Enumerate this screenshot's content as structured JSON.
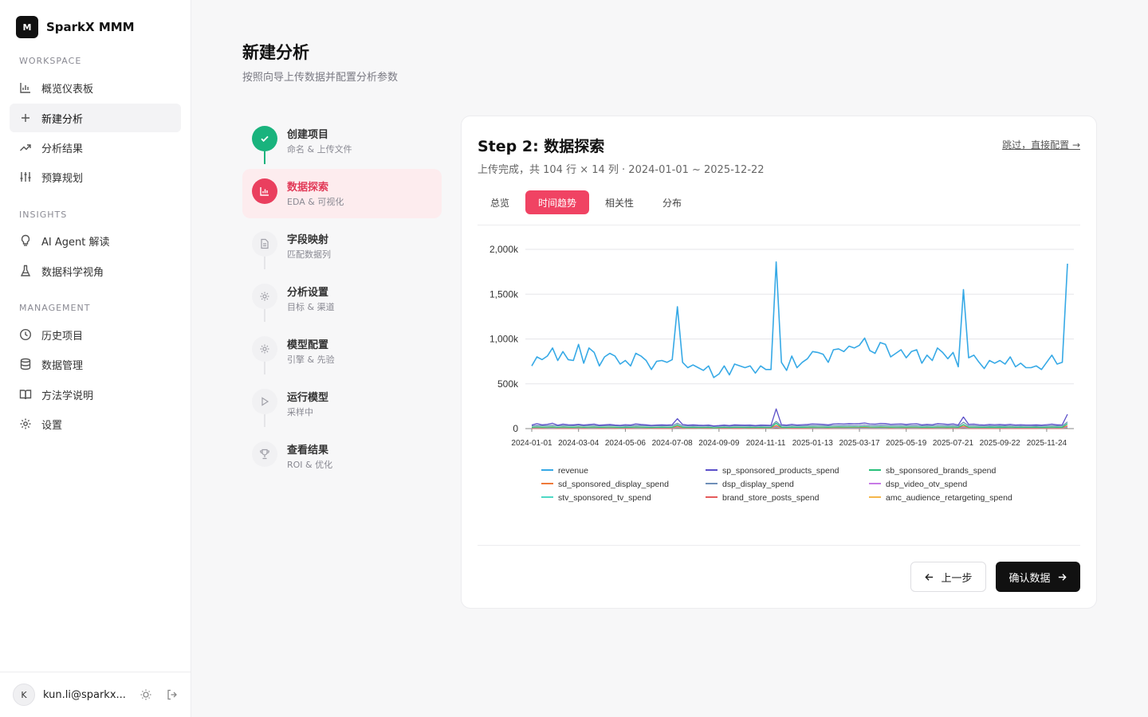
{
  "app": {
    "logo_letter": "M",
    "name": "SparkX MMM"
  },
  "sidebar": {
    "workspace_label": "WORKSPACE",
    "insights_label": "INSIGHTS",
    "management_label": "MANAGEMENT",
    "items": [
      {
        "label": "概览仪表板",
        "icon": "bar-chart-icon"
      },
      {
        "label": "新建分析",
        "icon": "plus-icon",
        "active": true
      },
      {
        "label": "分析结果",
        "icon": "trending-up-icon"
      },
      {
        "label": "预算规划",
        "icon": "sliders-icon"
      },
      {
        "label": "AI Agent 解读",
        "icon": "lightbulb-icon"
      },
      {
        "label": "数据科学视角",
        "icon": "flask-icon"
      },
      {
        "label": "历史项目",
        "icon": "clock-icon"
      },
      {
        "label": "数据管理",
        "icon": "database-icon"
      },
      {
        "label": "方法学说明",
        "icon": "book-icon"
      },
      {
        "label": "设置",
        "icon": "gear-icon"
      }
    ]
  },
  "user": {
    "avatar": "K",
    "email": "kun.li@sparkx..."
  },
  "page": {
    "title": "新建分析",
    "subtitle": "按照向导上传数据并配置分析参数"
  },
  "steps": [
    {
      "title": "创建项目",
      "sub": "命名 & 上传文件",
      "status": "done",
      "icon": "check-icon"
    },
    {
      "title": "数据探索",
      "sub": "EDA & 可视化",
      "status": "current",
      "icon": "bar-chart-icon"
    },
    {
      "title": "字段映射",
      "sub": "匹配数据列",
      "status": "pending",
      "icon": "file-icon"
    },
    {
      "title": "分析设置",
      "sub": "目标 & 渠道",
      "status": "pending",
      "icon": "gear-icon"
    },
    {
      "title": "模型配置",
      "sub": "引擎 & 先验",
      "status": "pending",
      "icon": "gear-icon"
    },
    {
      "title": "运行模型",
      "sub": "采样中",
      "status": "pending",
      "icon": "play-icon"
    },
    {
      "title": "查看结果",
      "sub": "ROI & 优化",
      "status": "pending",
      "icon": "trophy-icon"
    }
  ],
  "card": {
    "title": "Step 2: 数据探索",
    "skip": "跳过，直接配置 →",
    "info": "上传完成，共 104 行 × 14 列 · 2024-01-01 ~ 2025-12-22",
    "tabs": [
      "总览",
      "时间趋势",
      "相关性",
      "分布"
    ],
    "active_tab": 1,
    "prev_label": "上一步",
    "next_label": "确认数据"
  },
  "chart_data": {
    "type": "line",
    "x_start": "2024-01-01",
    "x_end": "2025-12-22",
    "x_tick_labels": [
      "2024-01-01",
      "2024-03-04",
      "2024-05-06",
      "2024-07-08",
      "2024-09-09",
      "2024-11-11",
      "2025-01-13",
      "2025-03-17",
      "2025-05-19",
      "2025-07-21",
      "2025-09-22",
      "2025-11-24"
    ],
    "y_tick_labels": [
      "0",
      "500k",
      "1,000k",
      "1,500k",
      "2,000k"
    ],
    "y_ticks": [
      0,
      500,
      1000,
      1500,
      2000
    ],
    "y_unit": "k",
    "ylim": [
      0,
      2000
    ],
    "grid": "horizontal",
    "legend_position": "bottom",
    "series": [
      {
        "name": "revenue",
        "color": "#36a9e6",
        "values": [
          700,
          800,
          770,
          810,
          900,
          760,
          860,
          770,
          760,
          940,
          730,
          900,
          850,
          700,
          800,
          840,
          810,
          720,
          760,
          700,
          840,
          810,
          760,
          660,
          750,
          760,
          740,
          770,
          1360,
          740,
          680,
          710,
          680,
          650,
          700,
          570,
          610,
          700,
          600,
          720,
          700,
          680,
          700,
          620,
          700,
          660,
          660,
          1860,
          740,
          650,
          810,
          680,
          740,
          780,
          860,
          850,
          830,
          740,
          880,
          890,
          860,
          920,
          900,
          930,
          1010,
          870,
          840,
          960,
          940,
          800,
          840,
          880,
          790,
          860,
          880,
          730,
          820,
          760,
          900,
          850,
          780,
          850,
          690,
          1550,
          790,
          820,
          740,
          670,
          760,
          730,
          760,
          720,
          800,
          690,
          730,
          680,
          680,
          700,
          660,
          740,
          820,
          720,
          740,
          1840
        ]
      },
      {
        "name": "sp_sponsored_products_spend",
        "color": "#5b4fc9",
        "values": [
          40,
          55,
          42,
          48,
          60,
          38,
          50,
          44,
          42,
          48,
          40,
          45,
          50,
          38,
          42,
          46,
          40,
          36,
          44,
          40,
          52,
          46,
          42,
          36,
          40,
          42,
          40,
          44,
          110,
          46,
          38,
          42,
          38,
          36,
          40,
          30,
          34,
          40,
          34,
          42,
          40,
          38,
          40,
          34,
          40,
          38,
          36,
          220,
          44,
          38,
          48,
          40,
          44,
          46,
          52,
          50,
          48,
          42,
          52,
          54,
          52,
          56,
          54,
          56,
          62,
          52,
          50,
          58,
          56,
          48,
          50,
          52,
          46,
          52,
          54,
          42,
          48,
          44,
          56,
          52,
          46,
          52,
          40,
          130,
          48,
          50,
          44,
          40,
          46,
          44,
          46,
          42,
          48,
          40,
          44,
          40,
          40,
          42,
          38,
          44,
          50,
          42,
          44,
          160
        ]
      },
      {
        "name": "sb_sponsored_brands_spend",
        "color": "#27c07a",
        "values": [
          15,
          18,
          16,
          17,
          20,
          14,
          18,
          16,
          15,
          19,
          14,
          17,
          18,
          14,
          16,
          17,
          16,
          13,
          15,
          14,
          18,
          17,
          15,
          12,
          14,
          15,
          14,
          15,
          40,
          15,
          13,
          14,
          13,
          12,
          14,
          10,
          12,
          14,
          12,
          14,
          14,
          13,
          14,
          12,
          14,
          13,
          12,
          60,
          15,
          13,
          16,
          14,
          15,
          16,
          18,
          17,
          17,
          15,
          18,
          19,
          18,
          19,
          19,
          20,
          22,
          18,
          17,
          20,
          19,
          16,
          17,
          18,
          16,
          18,
          18,
          15,
          17,
          15,
          19,
          18,
          16,
          18,
          14,
          45,
          16,
          17,
          15,
          14,
          16,
          15,
          16,
          15,
          17,
          14,
          15,
          14,
          14,
          15,
          13,
          15,
          17,
          15,
          15,
          55
        ]
      },
      {
        "name": "sd_sponsored_display_spend",
        "color": "#ef7a3a",
        "values": [
          10,
          12,
          11,
          12,
          14,
          10,
          12,
          11,
          10,
          13,
          10,
          12,
          12,
          10,
          11,
          12,
          11,
          9,
          10,
          10,
          12,
          12,
          11,
          8,
          10,
          10,
          10,
          11,
          25,
          10,
          9,
          10,
          9,
          8,
          10,
          7,
          8,
          10,
          8,
          10,
          10,
          9,
          10,
          8,
          10,
          9,
          8,
          35,
          10,
          9,
          11,
          10,
          10,
          11,
          12,
          12,
          12,
          10,
          12,
          13,
          12,
          13,
          13,
          14,
          15,
          12,
          12,
          14,
          13,
          11,
          12,
          12,
          11,
          12,
          12,
          10,
          11,
          10,
          13,
          12,
          11,
          12,
          10,
          28,
          11,
          12,
          10,
          10,
          11,
          10,
          11,
          10,
          12,
          10,
          10,
          10,
          10,
          10,
          9,
          10,
          12,
          10,
          10,
          32
        ]
      },
      {
        "name": "dsp_display_spend",
        "color": "#6f8fb8",
        "values": [
          30,
          34,
          32,
          33,
          38,
          30,
          34,
          32,
          31,
          36,
          29,
          34,
          34,
          29,
          32,
          33,
          32,
          28,
          30,
          29,
          34,
          33,
          31,
          27,
          30,
          30,
          30,
          31,
          60,
          30,
          28,
          29,
          28,
          27,
          29,
          24,
          26,
          29,
          26,
          29,
          29,
          28,
          29,
          26,
          29,
          28,
          27,
          80,
          30,
          28,
          32,
          29,
          30,
          32,
          34,
          34,
          33,
          30,
          35,
          35,
          34,
          36,
          35,
          36,
          40,
          34,
          33,
          38,
          37,
          32,
          33,
          35,
          32,
          34,
          35,
          30,
          33,
          31,
          36,
          34,
          31,
          34,
          28,
          70,
          32,
          33,
          30,
          28,
          31,
          30,
          31,
          29,
          32,
          28,
          30,
          28,
          28,
          29,
          27,
          30,
          33,
          29,
          30,
          75
        ]
      },
      {
        "name": "dsp_video_otv_spend",
        "color": "#c77ae6",
        "values": [
          8,
          9,
          8,
          9,
          10,
          8,
          9,
          8,
          8,
          10,
          7,
          9,
          9,
          7,
          8,
          9,
          8,
          7,
          8,
          7,
          9,
          9,
          8,
          6,
          7,
          8,
          7,
          8,
          18,
          8,
          7,
          7,
          7,
          6,
          7,
          5,
          6,
          7,
          6,
          7,
          7,
          7,
          7,
          6,
          7,
          7,
          6,
          25,
          8,
          7,
          8,
          7,
          8,
          8,
          9,
          9,
          9,
          8,
          9,
          10,
          9,
          10,
          10,
          10,
          11,
          9,
          9,
          10,
          10,
          8,
          9,
          9,
          8,
          9,
          9,
          8,
          8,
          8,
          10,
          9,
          8,
          9,
          7,
          20,
          8,
          9,
          8,
          7,
          8,
          8,
          8,
          7,
          8,
          7,
          8,
          7,
          7,
          7,
          7,
          8,
          9,
          7,
          8,
          22
        ]
      },
      {
        "name": "stv_sponsored_tv_spend",
        "color": "#4ed8c5",
        "values": [
          5,
          6,
          5,
          6,
          7,
          5,
          6,
          5,
          5,
          6,
          5,
          6,
          6,
          5,
          5,
          6,
          5,
          4,
          5,
          5,
          6,
          6,
          5,
          4,
          5,
          5,
          5,
          5,
          12,
          5,
          4,
          5,
          4,
          4,
          5,
          3,
          4,
          5,
          4,
          5,
          5,
          4,
          5,
          4,
          5,
          4,
          4,
          18,
          5,
          4,
          5,
          5,
          5,
          5,
          6,
          6,
          6,
          5,
          6,
          6,
          6,
          6,
          6,
          7,
          7,
          6,
          6,
          7,
          6,
          5,
          6,
          6,
          5,
          6,
          6,
          5,
          5,
          5,
          6,
          6,
          5,
          6,
          5,
          14,
          5,
          6,
          5,
          5,
          5,
          5,
          5,
          5,
          5,
          5,
          5,
          5,
          5,
          5,
          4,
          5,
          6,
          5,
          5,
          15
        ]
      },
      {
        "name": "brand_store_posts_spend",
        "color": "#e55a5a",
        "values": [
          3,
          4,
          3,
          4,
          4,
          3,
          4,
          3,
          3,
          4,
          3,
          4,
          4,
          3,
          3,
          4,
          3,
          3,
          3,
          3,
          4,
          4,
          3,
          2,
          3,
          3,
          3,
          3,
          8,
          3,
          3,
          3,
          3,
          2,
          3,
          2,
          2,
          3,
          2,
          3,
          3,
          3,
          3,
          2,
          3,
          3,
          2,
          10,
          3,
          3,
          3,
          3,
          3,
          3,
          4,
          4,
          4,
          3,
          4,
          4,
          4,
          4,
          4,
          4,
          5,
          4,
          4,
          4,
          4,
          3,
          4,
          4,
          3,
          4,
          4,
          3,
          3,
          3,
          4,
          4,
          3,
          4,
          3,
          8,
          3,
          4,
          3,
          3,
          3,
          3,
          3,
          3,
          3,
          3,
          3,
          3,
          3,
          3,
          3,
          3,
          4,
          3,
          3,
          9
        ]
      },
      {
        "name": "amc_audience_retargeting_spend",
        "color": "#f5b64a",
        "values": [
          6,
          7,
          6,
          7,
          8,
          6,
          7,
          6,
          6,
          7,
          6,
          7,
          7,
          6,
          6,
          7,
          6,
          5,
          6,
          6,
          7,
          7,
          6,
          5,
          6,
          6,
          6,
          6,
          14,
          6,
          5,
          6,
          5,
          5,
          6,
          4,
          5,
          6,
          5,
          6,
          6,
          5,
          6,
          5,
          6,
          5,
          5,
          20,
          6,
          5,
          6,
          6,
          6,
          6,
          7,
          7,
          7,
          6,
          7,
          7,
          7,
          7,
          7,
          8,
          8,
          7,
          7,
          8,
          7,
          6,
          7,
          7,
          6,
          7,
          7,
          6,
          6,
          6,
          7,
          7,
          6,
          7,
          6,
          16,
          6,
          7,
          6,
          6,
          6,
          6,
          6,
          6,
          6,
          6,
          6,
          6,
          6,
          6,
          5,
          6,
          7,
          6,
          6,
          18
        ]
      }
    ]
  }
}
